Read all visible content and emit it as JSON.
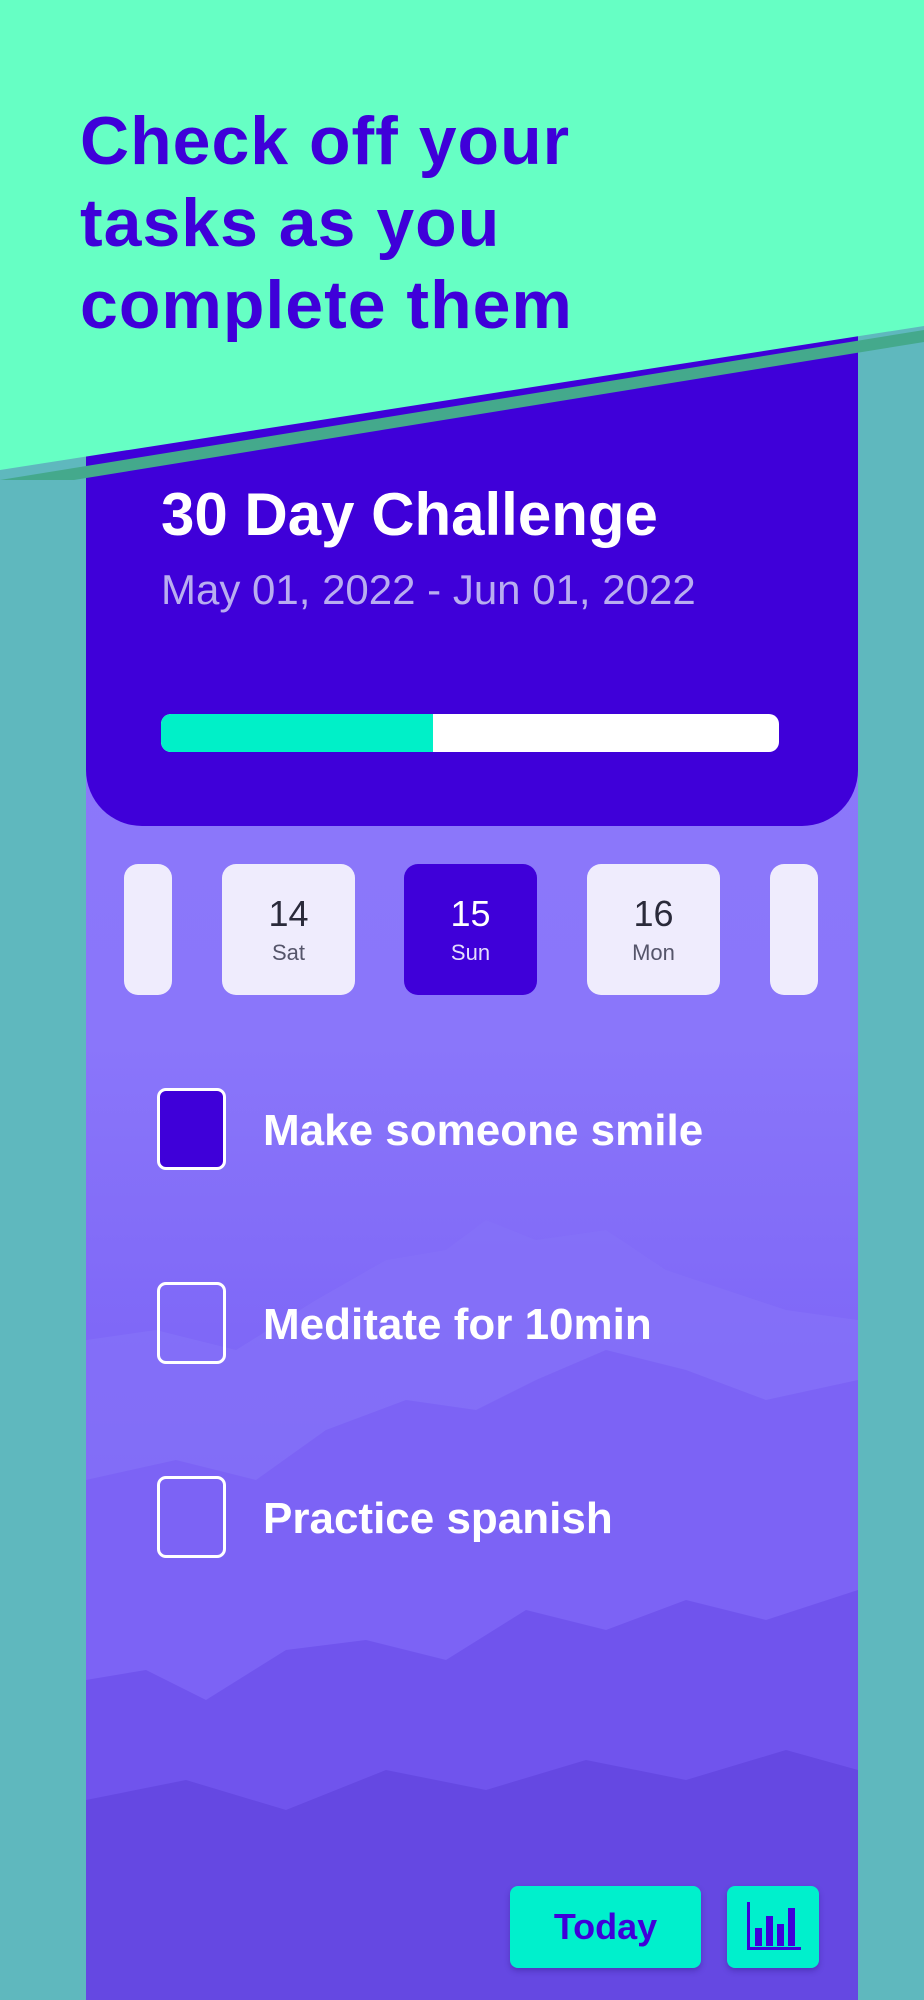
{
  "promo": {
    "headline_lines": [
      "Check off your",
      "tasks as you",
      "complete them"
    ]
  },
  "challenge": {
    "title": "30 Day Challenge",
    "date_range": "May 01, 2022 - Jun 01, 2022",
    "progress": 0.44
  },
  "calendar": {
    "days": [
      {
        "num": "14",
        "dow": "Sat",
        "selected": false
      },
      {
        "num": "15",
        "dow": "Sun",
        "selected": true
      },
      {
        "num": "16",
        "dow": "Mon",
        "selected": false
      }
    ]
  },
  "tasks": [
    {
      "label": "Make someone smile",
      "checked": true
    },
    {
      "label": "Meditate for 10min",
      "checked": false
    },
    {
      "label": "Practice spanish",
      "checked": false
    }
  ],
  "footer": {
    "today_label": "Today",
    "stats_icon": "bar-chart-icon"
  },
  "colors": {
    "accent": "#3f00d9",
    "mint": "#66ffc4",
    "teal_button": "#00f0cc",
    "progress_fill": "#00f0c8"
  }
}
